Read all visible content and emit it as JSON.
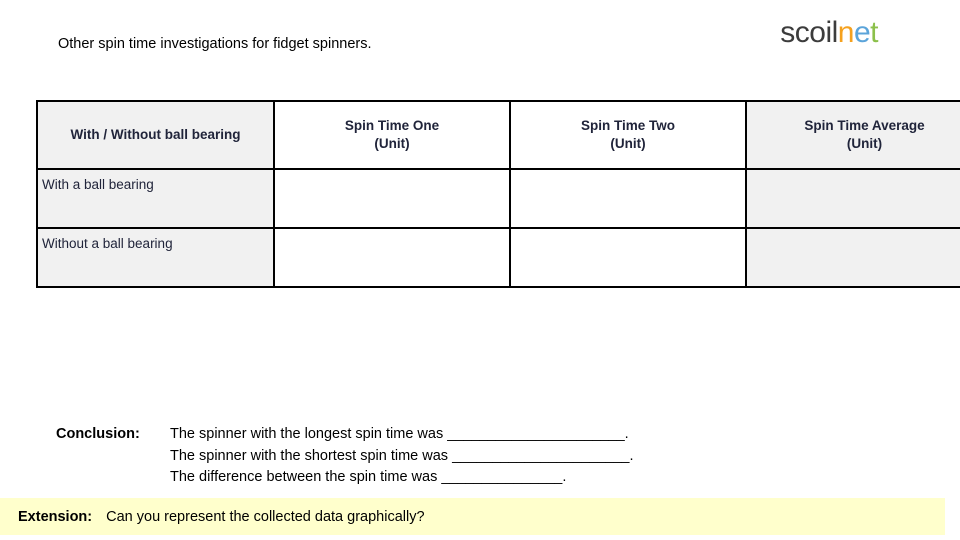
{
  "logo": {
    "name": "scoilnet-logo",
    "parts": [
      {
        "text": "scoil",
        "color": "#3c3c3c"
      },
      {
        "text": "n",
        "color": "#f5a11e"
      },
      {
        "text": "e",
        "color": "#5ba4da"
      },
      {
        "text": "t",
        "color": "#8cc04b"
      }
    ]
  },
  "title": "Other spin time investigations for fidget spinners.",
  "table": {
    "headers": [
      "With / Without ball bearing",
      "Spin Time One\n(Unit)",
      "Spin Time Two\n(Unit)",
      "Spin Time Average\n(Unit)"
    ],
    "rows": [
      {
        "label": "With a ball bearing",
        "spin_time_one": "",
        "spin_time_two": "",
        "spin_time_average": ""
      },
      {
        "label": "Without a ball bearing",
        "spin_time_one": "",
        "spin_time_two": "",
        "spin_time_average": ""
      }
    ],
    "shaded_color": "#f1f1f1",
    "border_color": "#000000",
    "text_color": "#20243a"
  },
  "conclusion": {
    "label": "Conclusion:",
    "lines": [
      "The spinner with the longest spin time was ______________________.",
      "The spinner with the shortest spin time was ______________________.",
      "The difference between the spin time was _______________."
    ]
  },
  "extension": {
    "label": "Extension:",
    "text": "Can you represent the collected data graphically?",
    "background": "#ffffcc"
  }
}
